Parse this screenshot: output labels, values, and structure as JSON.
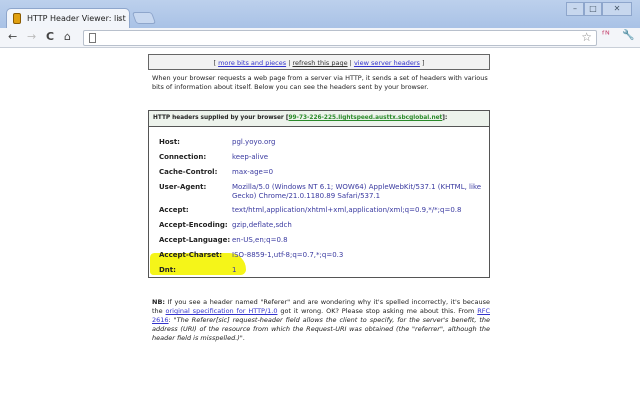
{
  "browser": {
    "tab_title": "HTTP Header Viewer: list b",
    "tab_close": "×",
    "window_buttons": [
      "–",
      "□",
      "✕"
    ],
    "nav": {
      "back": "←",
      "forward": "→",
      "reload": "C",
      "home": "⌂"
    },
    "star": "☆",
    "ext_icon": "ᶠᴺ",
    "wrench": "🔧"
  },
  "links": {
    "open": "[",
    "items": [
      "more bits and pieces",
      "refresh this page",
      "view server headers"
    ],
    "sep": "|",
    "close": "]"
  },
  "intro": "When your browser requests a web page from a server via HTTP, it sends a set of headers with various bits of information about itself. Below you can see the headers sent by your browser.",
  "headers_box": {
    "title": "HTTP headers supplied by your browser",
    "host_open": "[",
    "host": "99-73-226-225.lightspeed.austtx.sbcglobal.net",
    "host_close": "]:",
    "rows": [
      {
        "name": "Host:",
        "value": "pgl.yoyo.org"
      },
      {
        "name": "Connection:",
        "value": "keep-alive"
      },
      {
        "name": "Cache-Control:",
        "value": "max-age=0"
      },
      {
        "name": "User-Agent:",
        "value": "Mozilla/5.0 (Windows NT 6.1; WOW64) AppleWebKit/537.1 (KHTML, like Gecko) Chrome/21.0.1180.89 Safari/537.1"
      },
      {
        "name": "Accept:",
        "value": "text/html,application/xhtml+xml,application/xml;q=0.9,*/*;q=0.8"
      },
      {
        "name": "Accept-Encoding:",
        "value": "gzip,deflate,sdch"
      },
      {
        "name": "Accept-Language:",
        "value": "en-US,en;q=0.8"
      },
      {
        "name": "Accept-Charset:",
        "value": "ISO-8859-1,utf-8;q=0.7,*;q=0.3"
      },
      {
        "name": "Dnt:",
        "value": "1"
      }
    ]
  },
  "nb": {
    "label": "NB:",
    "t1": " If you see a header named \"Referer\" and are wondering why it's spelled incorrectly, it's because the ",
    "link1": "original specification for HTTP/1.0",
    "t2": " got it wrong. OK? Please stop asking me about this. From ",
    "link2": "RFC 2616",
    "t3": ": ",
    "quote": "\"The Referer[sic] request-header field allows the client to specify, for the server's benefit, the address (URI) of the resource from which the Request-URI was obtained (the \"referrer\", although the header field is misspelled.)\"",
    "end": "."
  }
}
